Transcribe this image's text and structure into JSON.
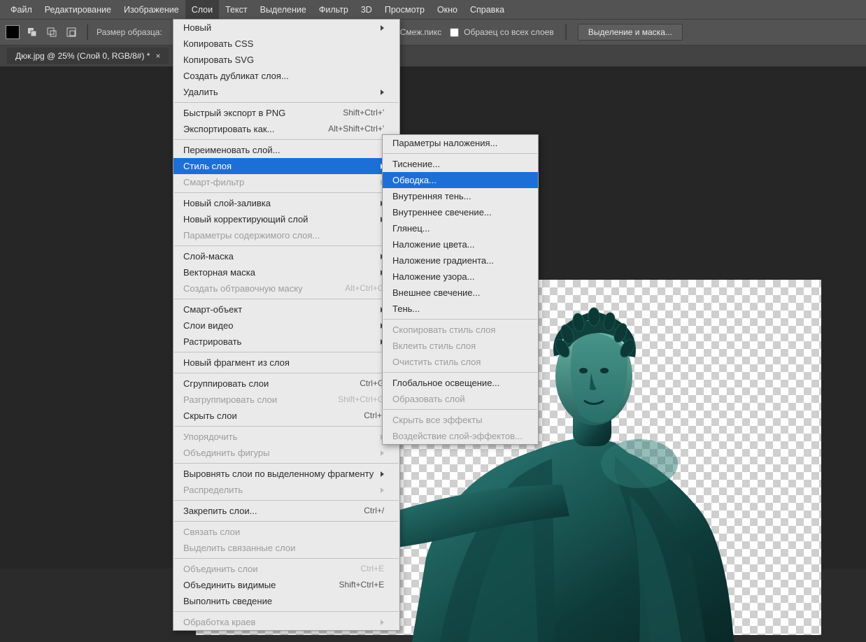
{
  "menubar": {
    "items": [
      "Файл",
      "Редактирование",
      "Изображение",
      "Слои",
      "Текст",
      "Выделение",
      "Фильтр",
      "3D",
      "Просмотр",
      "Окно",
      "Справка"
    ],
    "open_index": 3
  },
  "optionsbar": {
    "sample_size_label": "Размер образца:",
    "contig_label": "Смеж.пикс",
    "all_layers_label": "Образец со всех слоев",
    "select_mask_btn": "Выделение и маска..."
  },
  "tab": {
    "title": "Дюк.jpg @ 25% (Слой 0, RGB/8#) *"
  },
  "menu_main": [
    {
      "label": "Новый",
      "arrow": true
    },
    {
      "label": "Копировать CSS"
    },
    {
      "label": "Копировать SVG"
    },
    {
      "label": "Создать дубликат слоя..."
    },
    {
      "label": "Удалить",
      "arrow": true
    },
    {
      "sep": true
    },
    {
      "label": "Быстрый экспорт в PNG",
      "shortcut": "Shift+Ctrl+'"
    },
    {
      "label": "Экспортировать как...",
      "shortcut": "Alt+Shift+Ctrl+'"
    },
    {
      "sep": true
    },
    {
      "label": "Переименовать слой..."
    },
    {
      "label": "Стиль слоя",
      "arrow": true,
      "hover": true
    },
    {
      "label": "Смарт-фильтр",
      "arrow": true,
      "dis": true
    },
    {
      "sep": true
    },
    {
      "label": "Новый слой-заливка",
      "arrow": true
    },
    {
      "label": "Новый корректирующий слой",
      "arrow": true
    },
    {
      "label": "Параметры содержимого слоя...",
      "dis": true
    },
    {
      "sep": true
    },
    {
      "label": "Слой-маска",
      "arrow": true
    },
    {
      "label": "Векторная маска",
      "arrow": true
    },
    {
      "label": "Создать обтравочную маску",
      "shortcut": "Alt+Ctrl+G",
      "dis": true
    },
    {
      "sep": true
    },
    {
      "label": "Смарт-объект",
      "arrow": true
    },
    {
      "label": "Слои видео",
      "arrow": true
    },
    {
      "label": "Растрировать",
      "arrow": true
    },
    {
      "sep": true
    },
    {
      "label": "Новый фрагмент из слоя"
    },
    {
      "sep": true
    },
    {
      "label": "Сгруппировать слои",
      "shortcut": "Ctrl+G"
    },
    {
      "label": "Разгруппировать слои",
      "shortcut": "Shift+Ctrl+G",
      "dis": true
    },
    {
      "label": "Скрыть слои",
      "shortcut": "Ctrl+,"
    },
    {
      "sep": true
    },
    {
      "label": "Упорядочить",
      "arrow": true,
      "dis": true
    },
    {
      "label": "Объединить фигуры",
      "arrow": true,
      "dis": true
    },
    {
      "sep": true
    },
    {
      "label": "Выровнять слои по выделенному фрагменту",
      "arrow": true
    },
    {
      "label": "Распределить",
      "arrow": true,
      "dis": true
    },
    {
      "sep": true
    },
    {
      "label": "Закрепить слои...",
      "shortcut": "Ctrl+/"
    },
    {
      "sep": true
    },
    {
      "label": "Связать слои",
      "dis": true
    },
    {
      "label": "Выделить связанные слои",
      "dis": true
    },
    {
      "sep": true
    },
    {
      "label": "Объединить слои",
      "shortcut": "Ctrl+E",
      "dis": true
    },
    {
      "label": "Объединить видимые",
      "shortcut": "Shift+Ctrl+E"
    },
    {
      "label": "Выполнить сведение"
    },
    {
      "sep": true
    },
    {
      "label": "Обработка краев",
      "arrow": true,
      "dis": true
    }
  ],
  "menu_sub": [
    {
      "label": "Параметры наложения..."
    },
    {
      "sep": true
    },
    {
      "label": "Тиснение..."
    },
    {
      "label": "Обводка...",
      "hover": true
    },
    {
      "label": "Внутренняя тень..."
    },
    {
      "label": "Внутреннее свечение..."
    },
    {
      "label": "Глянец..."
    },
    {
      "label": "Наложение цвета..."
    },
    {
      "label": "Наложение градиента..."
    },
    {
      "label": "Наложение узора..."
    },
    {
      "label": "Внешнее свечение..."
    },
    {
      "label": "Тень..."
    },
    {
      "sep": true
    },
    {
      "label": "Скопировать стиль слоя",
      "dis": true
    },
    {
      "label": "Вклеить стиль слоя",
      "dis": true
    },
    {
      "label": "Очистить стиль слоя",
      "dis": true
    },
    {
      "sep": true
    },
    {
      "label": "Глобальное освещение..."
    },
    {
      "label": "Образовать слой",
      "dis": true
    },
    {
      "sep": true
    },
    {
      "label": "Скрыть все эффекты",
      "dis": true
    },
    {
      "label": "Воздействие слой-эффектов...",
      "dis": true
    }
  ]
}
